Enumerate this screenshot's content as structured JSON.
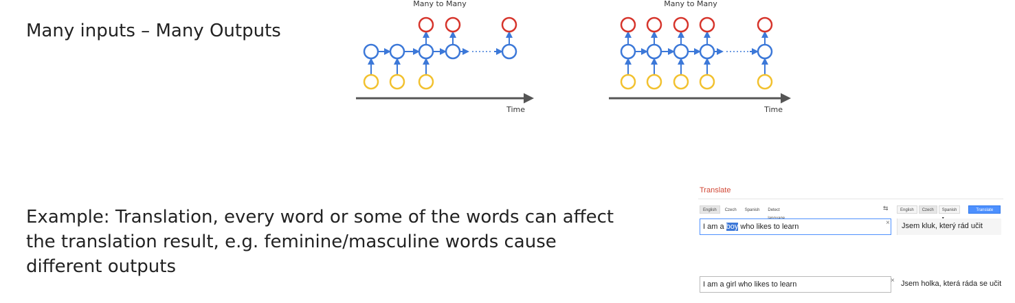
{
  "heading": "Many inputs – Many Outputs",
  "example": "Example: Translation, every word or some of the words can affect the translation result, e.g. feminine/masculine words cause different outputs",
  "diagrams": [
    {
      "title": "Many to Many",
      "axis_label": "Time",
      "has_input_at": [
        true,
        true,
        true,
        false,
        false
      ],
      "has_output_at": [
        false,
        false,
        true,
        true,
        true
      ]
    },
    {
      "title": "Many to Many",
      "axis_label": "Time",
      "has_input_at": [
        true,
        true,
        true,
        true,
        true
      ],
      "has_output_at": [
        true,
        true,
        true,
        true,
        true
      ]
    }
  ],
  "colors": {
    "input": "#f2c12e",
    "hidden": "#3c78d8",
    "output": "#d6342b",
    "axis": "#555555"
  },
  "translate": {
    "title": "Translate",
    "source_langs": [
      "English",
      "Czech",
      "Spanish",
      "Detect language ▾"
    ],
    "target_langs": [
      "English",
      "Czech",
      "Spanish ▾"
    ],
    "swap_icon": "⇆",
    "translate_button": "Translate",
    "clear_icon": "×",
    "example1": {
      "input_before": "I am a ",
      "input_highlight": "boy",
      "input_after": " who likes to learn",
      "output": "Jsem kluk, který rád učit"
    },
    "example2": {
      "input": "I am a girl who likes to learn",
      "output": "Jsem holka, která ráda se učit"
    }
  }
}
